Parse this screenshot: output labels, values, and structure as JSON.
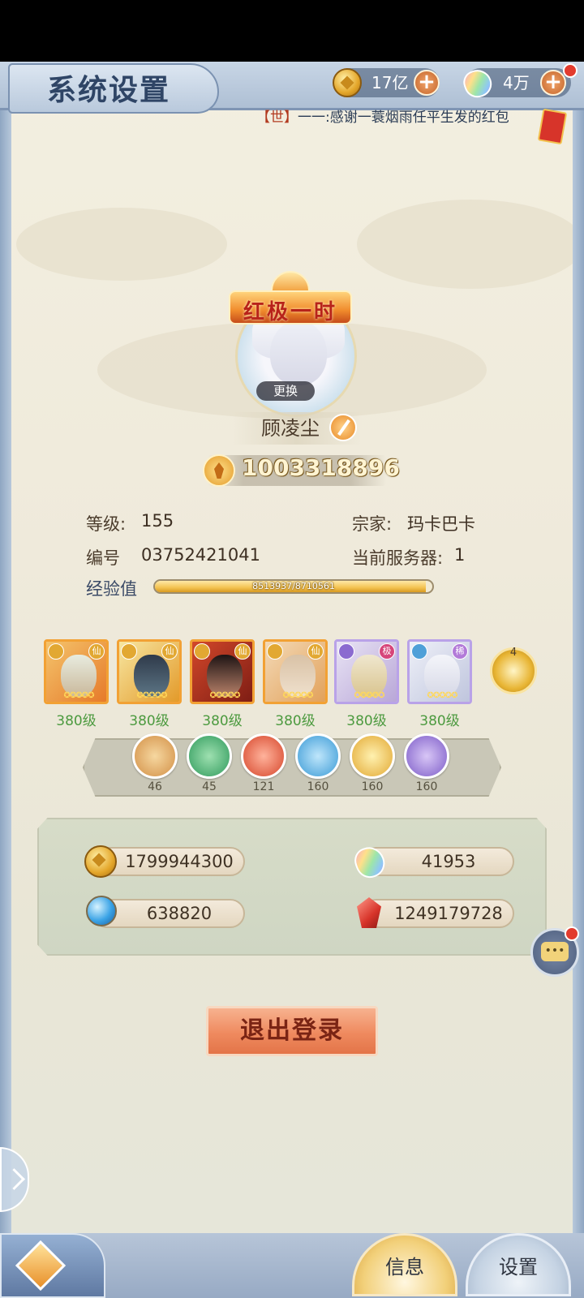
{
  "header": {
    "title": "系统设置",
    "gold": "17亿",
    "gems": "4万",
    "ticker_tag": "【世】",
    "ticker_text": "一一:感谢一蓑烟雨任平生发的红包"
  },
  "profile": {
    "title_badge": "红极一时",
    "change_label": "更换",
    "name": "顾凌尘",
    "power": "1003318896"
  },
  "info": {
    "level_label": "等级:",
    "level_value": "155",
    "clan_label": "宗家:",
    "clan_value": "玛卡巴卡",
    "id_label": "编号",
    "id_value": "03752421041",
    "server_label": "当前服务器:",
    "server_value": "1",
    "exp_label": "经验值",
    "exp_text": "8513937/8710561",
    "exp_fraction": 0.977
  },
  "heroes": [
    {
      "level": "380级",
      "rank": "仙",
      "stars": "✪✪✪✪✪",
      "frame": "orange"
    },
    {
      "level": "380级",
      "rank": "仙",
      "stars": "✪✪✪✪✪",
      "frame": "orange"
    },
    {
      "level": "380级",
      "rank": "仙",
      "stars": "✪✪✪✪✪",
      "frame": "orange"
    },
    {
      "level": "380级",
      "rank": "仙",
      "stars": "✪✪✪✪✪",
      "frame": "orange"
    },
    {
      "level": "380级",
      "rank": "极",
      "stars": "✪✪✪✪✪",
      "frame": "purple"
    },
    {
      "level": "380级",
      "rank": "稀",
      "stars": "✪✪✪✪✪",
      "frame": "purple"
    }
  ],
  "badge_count": "4",
  "elements": [
    {
      "name": "mountain",
      "value": "46"
    },
    {
      "name": "wind",
      "value": "45"
    },
    {
      "name": "fire",
      "value": "121"
    },
    {
      "name": "water",
      "value": "160"
    },
    {
      "name": "sun",
      "value": "160"
    },
    {
      "name": "moon",
      "value": "160"
    }
  ],
  "wealth": {
    "gold": "1799944300",
    "gems": "41953",
    "orbs": "638820",
    "crystals": "1249179728"
  },
  "logout_label": "退出登录",
  "tabs": {
    "info": "信息",
    "settings": "设置"
  }
}
